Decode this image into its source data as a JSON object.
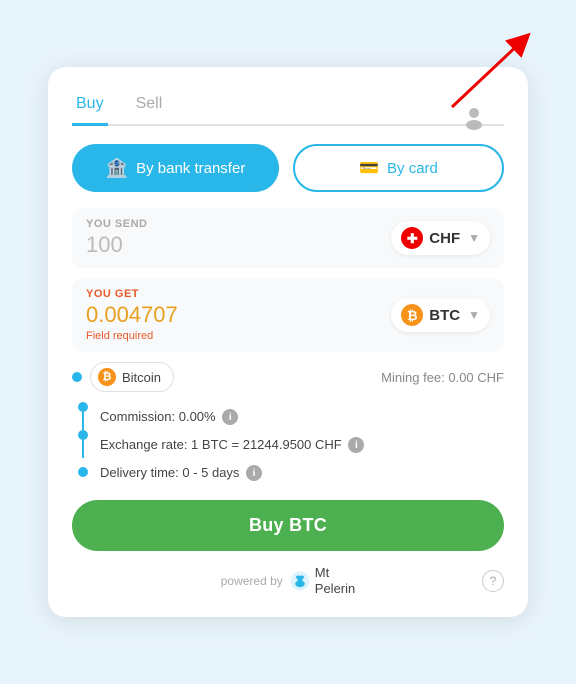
{
  "tabs": [
    {
      "label": "Buy",
      "active": true
    },
    {
      "label": "Sell",
      "active": false
    }
  ],
  "payment": {
    "bank_label": "By bank transfer",
    "card_label": "By card"
  },
  "send": {
    "label": "YOU SEND",
    "value": "100",
    "currency": "CHF"
  },
  "receive": {
    "label": "YOU GET",
    "value": "0.004707",
    "currency": "BTC",
    "field_required": "Field required"
  },
  "coin": {
    "name": "Bitcoin"
  },
  "mining_fee": "Mining fee: 0.00 CHF",
  "details": {
    "commission": "Commission: 0.00%",
    "exchange_rate": "Exchange rate: 1 BTC = 21244.9500 CHF",
    "delivery": "Delivery time: 0 - 5 days"
  },
  "buy_button": "Buy BTC",
  "footer": {
    "powered_by": "powered by",
    "brand": "Mt\nPelerin"
  },
  "icons": {
    "bank": "🏦",
    "card": "💳",
    "profile": "👤",
    "info": "i",
    "help": "?"
  }
}
